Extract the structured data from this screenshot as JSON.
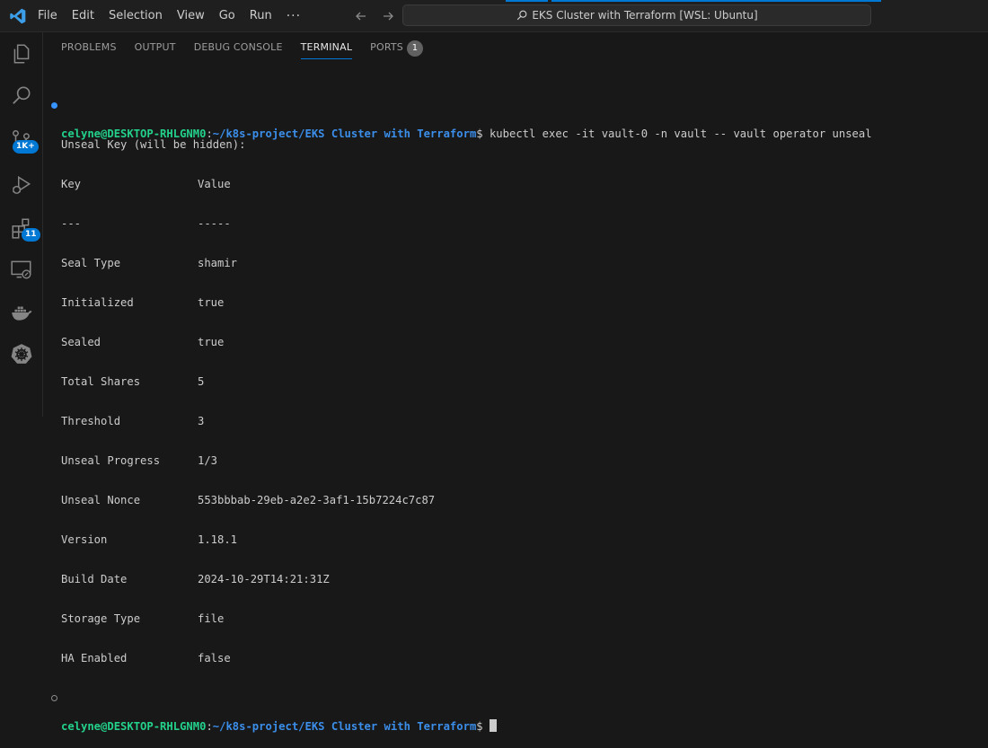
{
  "menu": [
    "File",
    "Edit",
    "Selection",
    "View",
    "Go",
    "Run"
  ],
  "menu_more": "···",
  "command_center": "EKS Cluster with Terraform [WSL: Ubuntu]",
  "activity": {
    "scm_badge": "1K+",
    "extensions_badge": "11"
  },
  "panel_tabs": {
    "problems": "PROBLEMS",
    "output": "OUTPUT",
    "debug": "DEBUG CONSOLE",
    "terminal": "TERMINAL",
    "ports": "PORTS",
    "ports_count": "1"
  },
  "terminal": {
    "user": "celyne@DESKTOP-RHLGNM0",
    "colon": ":",
    "path": "~/k8s-project/EKS Cluster with Terraform",
    "prompt": "$ ",
    "command": "kubectl exec -it vault-0 -n vault -- vault operator unseal",
    "unseal_prompt": "Unseal Key (will be hidden):",
    "header_key": "Key",
    "header_value": "Value",
    "sep_key": "---",
    "sep_value": "-----",
    "rows": [
      {
        "key": "Seal Type",
        "value": "shamir"
      },
      {
        "key": "Initialized",
        "value": "true"
      },
      {
        "key": "Sealed",
        "value": "true"
      },
      {
        "key": "Total Shares",
        "value": "5"
      },
      {
        "key": "Threshold",
        "value": "3"
      },
      {
        "key": "Unseal Progress",
        "value": "1/3"
      },
      {
        "key": "Unseal Nonce",
        "value": "553bbbab-29eb-a2e2-3af1-15b7224c7c87"
      },
      {
        "key": "Version",
        "value": "1.18.1"
      },
      {
        "key": "Build Date",
        "value": "2024-10-29T14:21:31Z"
      },
      {
        "key": "Storage Type",
        "value": "file"
      },
      {
        "key": "HA Enabled",
        "value": "false"
      }
    ],
    "final_prompt": "$"
  },
  "colors": {
    "accent": "#0078d4",
    "user_green": "#23d18b",
    "path_blue": "#3b8eea"
  }
}
